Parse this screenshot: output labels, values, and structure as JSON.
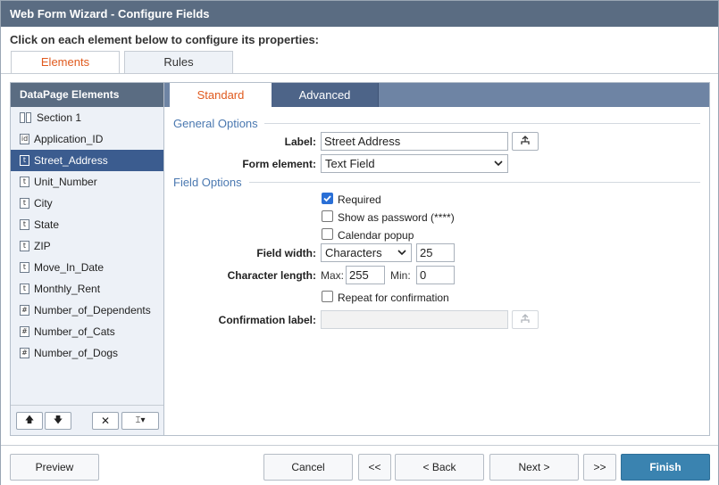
{
  "window": {
    "title": "Web Form Wizard - Configure Fields"
  },
  "instruction": "Click on each element below to configure its properties:",
  "outer_tabs": [
    {
      "label": "Elements",
      "active": true
    },
    {
      "label": "Rules",
      "active": false
    }
  ],
  "left_panel": {
    "title": "DataPage Elements",
    "items": [
      {
        "label": "Section 1",
        "icon": "section-icon"
      },
      {
        "label": "Application_ID",
        "icon": "id-icon",
        "glyph": "id"
      },
      {
        "label": "Street_Address",
        "icon": "text-field-icon",
        "glyph": "t",
        "selected": true
      },
      {
        "label": "Unit_Number",
        "icon": "text-field-icon",
        "glyph": "t"
      },
      {
        "label": "City",
        "icon": "text-field-icon",
        "glyph": "t"
      },
      {
        "label": "State",
        "icon": "text-field-icon",
        "glyph": "t"
      },
      {
        "label": "ZIP",
        "icon": "text-field-icon",
        "glyph": "t"
      },
      {
        "label": "Move_In_Date",
        "icon": "text-field-icon",
        "glyph": "t"
      },
      {
        "label": "Monthly_Rent",
        "icon": "text-field-icon",
        "glyph": "t"
      },
      {
        "label": "Number_of_Dependents",
        "icon": "number-field-icon",
        "glyph": "#"
      },
      {
        "label": "Number_of_Cats",
        "icon": "number-field-icon",
        "glyph": "#"
      },
      {
        "label": "Number_of_Dogs",
        "icon": "number-field-icon",
        "glyph": "#"
      }
    ],
    "toolbar": {
      "up": "🡅",
      "down": "🡇",
      "delete": "✕",
      "insert": "⌶▾"
    }
  },
  "inner_tabs": [
    {
      "label": "Standard",
      "active": true
    },
    {
      "label": "Advanced",
      "active": false
    }
  ],
  "general_options": {
    "title": "General Options",
    "label_caption": "Label:",
    "label_value": "Street Address",
    "form_element_caption": "Form element:",
    "form_element_value": "Text Field"
  },
  "field_options": {
    "title": "Field Options",
    "required": {
      "label": "Required",
      "checked": true
    },
    "show_password": {
      "label": "Show as password (****)",
      "checked": false
    },
    "calendar_popup": {
      "label": "Calendar popup",
      "checked": false
    },
    "field_width_caption": "Field width:",
    "field_width_unit": "Characters",
    "field_width_value": "25",
    "char_length_caption": "Character length:",
    "max_caption": "Max:",
    "max_value": "255",
    "min_caption": "Min:",
    "min_value": "0",
    "repeat_confirmation": {
      "label": "Repeat for confirmation",
      "checked": false
    },
    "confirmation_label_caption": "Confirmation label:",
    "confirmation_label_value": ""
  },
  "footer": {
    "preview": "Preview",
    "cancel": "Cancel",
    "first": "<<",
    "back": "< Back",
    "next": "Next >",
    "last": ">>",
    "finish": "Finish"
  },
  "colors": {
    "title_bar": "#5a6c82",
    "selected": "#3b5c8f",
    "accent": "#e05a1e",
    "finish": "#3a83b0"
  }
}
